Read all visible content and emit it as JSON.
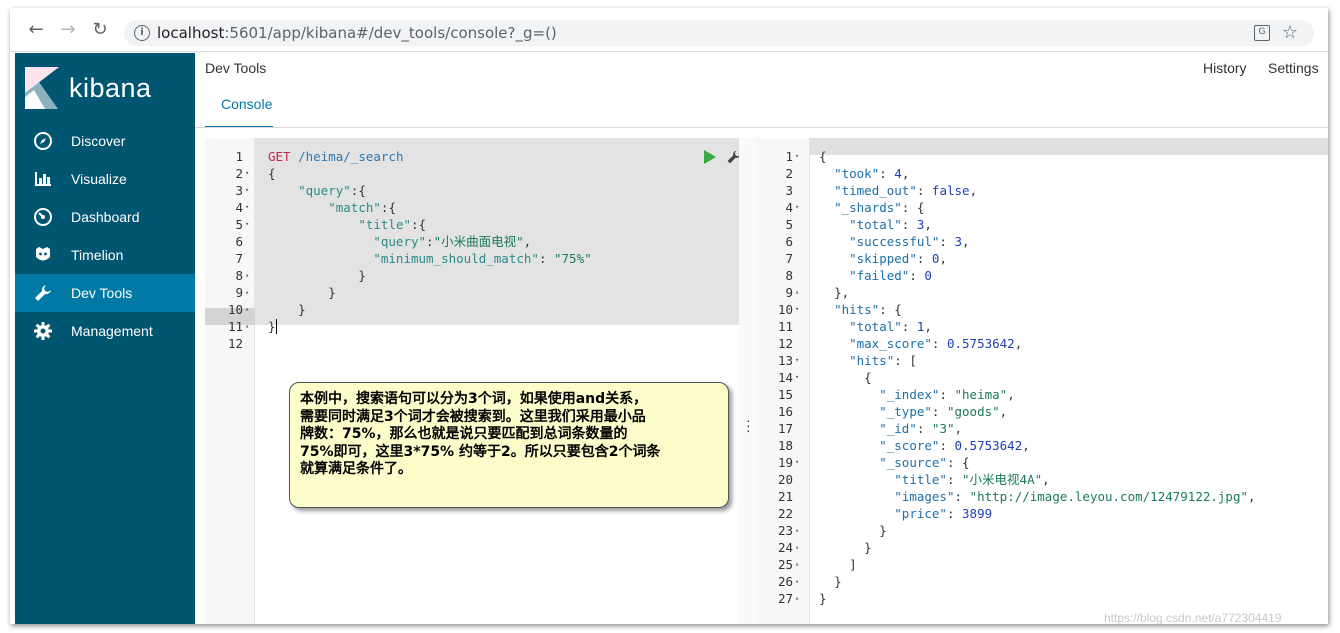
{
  "browser": {
    "url_host": "localhost",
    "url_rest": ":5601/app/kibana#/dev_tools/console?_g=()",
    "translate_icon_glyph": "G"
  },
  "sidebar": {
    "logo_text": "kibana",
    "items": [
      {
        "label": "Discover",
        "icon": "compass-icon"
      },
      {
        "label": "Visualize",
        "icon": "bar-chart-icon"
      },
      {
        "label": "Dashboard",
        "icon": "gauge-icon"
      },
      {
        "label": "Timelion",
        "icon": "timelion-icon"
      },
      {
        "label": "Dev Tools",
        "icon": "wrench-icon",
        "active": true
      },
      {
        "label": "Management",
        "icon": "gear-icon"
      }
    ],
    "colors": {
      "background": "#005571",
      "active": "#0079a5"
    }
  },
  "header": {
    "title": "Dev Tools",
    "history": "History",
    "settings": "Settings",
    "tab": "Console"
  },
  "request": {
    "line_numbers": [
      "1",
      "2",
      "3",
      "4",
      "5",
      "6",
      "7",
      "8",
      "9",
      "10",
      "11",
      "12"
    ],
    "method": "GET",
    "path": "/heima/_search",
    "lines": [
      "{",
      "    \"query\":{",
      "        \"match\":{",
      "            \"title\":{",
      "              \"query\":\"小米曲面电视\",",
      "              \"minimum_should_match\": \"75%\"",
      "            }",
      "        }",
      "    }",
      "}"
    ]
  },
  "response": {
    "line_numbers": [
      "1",
      "2",
      "3",
      "4",
      "5",
      "6",
      "7",
      "8",
      "9",
      "10",
      "11",
      "12",
      "13",
      "14",
      "15",
      "16",
      "17",
      "18",
      "19",
      "20",
      "21",
      "22",
      "23",
      "24",
      "25",
      "26",
      "27"
    ],
    "lines": [
      "{",
      "  \"took\": 4,",
      "  \"timed_out\": false,",
      "  \"_shards\": {",
      "    \"total\": 3,",
      "    \"successful\": 3,",
      "    \"skipped\": 0,",
      "    \"failed\": 0",
      "  },",
      "  \"hits\": {",
      "    \"total\": 1,",
      "    \"max_score\": 0.5753642,",
      "    \"hits\": [",
      "      {",
      "        \"_index\": \"heima\",",
      "        \"_type\": \"goods\",",
      "        \"_id\": \"3\",",
      "        \"_score\": 0.5753642,",
      "        \"_source\": {",
      "          \"title\": \"小米电视4A\",",
      "          \"images\": \"http://image.leyou.com/12479122.jpg\",",
      "          \"price\": 3899",
      "        }",
      "      }",
      "    ]",
      "  }",
      "}"
    ]
  },
  "note": {
    "text": "本例中，搜索语句可以分为3个词，如果使用and关系，\n需要同时满足3个词才会被搜索到。这里我们采用最小品\n牌数：75%，那么也就是说只要匹配到总词条数量的\n75%即可，这里3*75% 约等于2。所以只要包含2个词条\n就算满足条件了。"
  },
  "watermark": "https://blog.csdn.net/a772304419",
  "colors": {
    "method": "#c7254e",
    "url": "#2c7ab5",
    "key": "#2a8b86",
    "string": "#1a7a5a",
    "number": "#1e40b8",
    "play": "#39a845"
  }
}
